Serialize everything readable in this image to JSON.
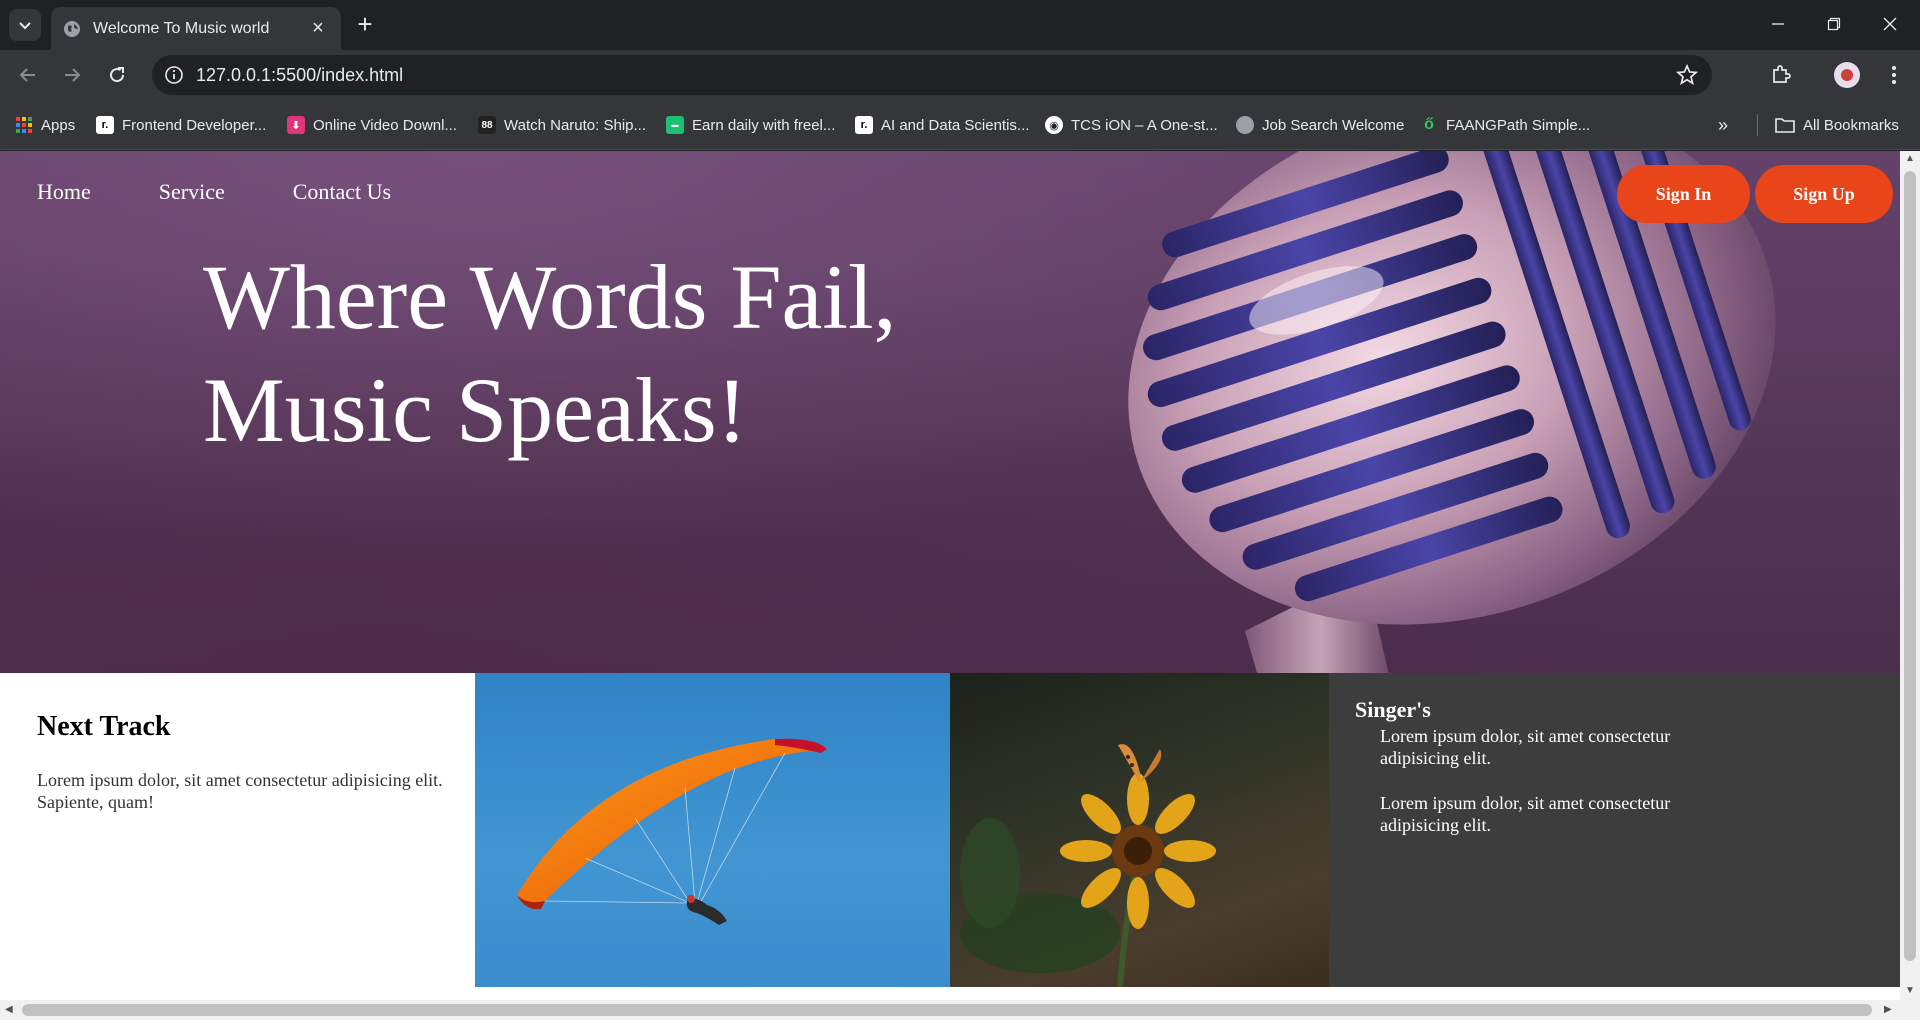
{
  "browser": {
    "tab_title": "Welcome To Music world",
    "url": "127.0.0.1:5500/index.html",
    "bookmarks": [
      {
        "label": "Apps",
        "icon": "apps-grid-icon"
      },
      {
        "label": "Frontend Developer...",
        "icon": "frontend-mentor-icon"
      },
      {
        "label": "Online Video Downl...",
        "icon": "video-download-icon"
      },
      {
        "label": "Watch Naruto: Ship...",
        "icon": "naruto-icon"
      },
      {
        "label": "Earn daily with freel...",
        "icon": "freelance-icon"
      },
      {
        "label": "AI and Data Scientis...",
        "icon": "ai-data-icon"
      },
      {
        "label": "TCS iON – A One-st...",
        "icon": "tcs-ion-icon"
      },
      {
        "label": "Job Search Welcome",
        "icon": "globe-icon"
      },
      {
        "label": "FAANGPath Simple...",
        "icon": "faangpath-icon"
      }
    ],
    "all_bookmarks": "All Bookmarks"
  },
  "page": {
    "nav": {
      "home": "Home",
      "service": "Service",
      "contact": "Contact Us"
    },
    "buttons": {
      "sign_in": "Sign In",
      "sign_up": "Sign Up"
    },
    "hero": {
      "line1": "Where Words Fail,",
      "line2": "Music Speaks!"
    },
    "next_track": {
      "title": "Next Track",
      "text": "Lorem ipsum dolor, sit amet consectetur adipisicing elit. Sapiente, quam!"
    },
    "singers": {
      "title": "Singer's",
      "para1": "Lorem ipsum dolor, sit amet consectetur adipisicing elit.",
      "para2": "Lorem ipsum dolor, sit amet consectetur adipisicing elit."
    }
  },
  "colors": {
    "accent": "#e8451a",
    "hero_bg": "#5a3a5e",
    "dark_card": "#3d3d3d"
  }
}
